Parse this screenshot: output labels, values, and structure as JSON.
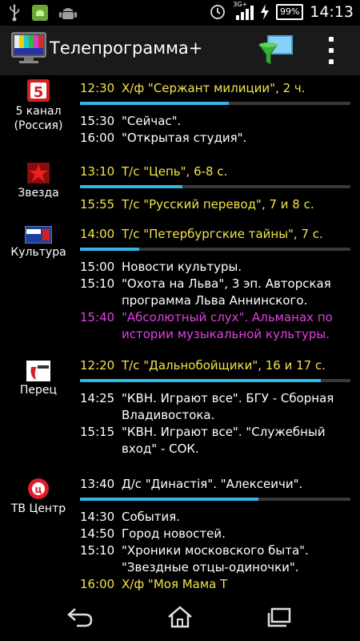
{
  "status_bar": {
    "time": "14:13",
    "battery": "99%",
    "network": "3G+",
    "icons": [
      "usb-icon",
      "android-robot-icon",
      "android-debug-icon",
      "vibrate-icon",
      "signal-icon",
      "charging-icon"
    ]
  },
  "action_bar": {
    "title": "Телепрограмма+",
    "icons": [
      "tv-app-icon",
      "filter-funnel-icon",
      "overflow-menu-icon"
    ]
  },
  "colors": {
    "now_playing": "#f2e34a",
    "highlighted": "#e040e0",
    "progress": "#33b5e5"
  },
  "channels": [
    {
      "name": "5 канал (Россия)",
      "name_line1": "5 канал",
      "name_line2": "(Россия)",
      "progress": 0.55,
      "programs": [
        {
          "time": "12:30",
          "title": "Х/ф \"Сержант милиции\", 2 ч.",
          "style": "now"
        },
        {
          "time": "15:30",
          "title": "\"Сейчас\".",
          "style": "normal"
        },
        {
          "time": "16:00",
          "title": "\"Открытая студия\".",
          "style": "normal"
        }
      ]
    },
    {
      "name": "Звезда",
      "progress": 0.38,
      "programs": [
        {
          "time": "13:10",
          "title": "Т/с \"Цепь\", 6-8 с.",
          "style": "now"
        },
        {
          "time": "15:55",
          "title": "Т/с \"Русский перевод\", 7 и 8 с.",
          "style": "now"
        }
      ]
    },
    {
      "name": "Культура",
      "logo_text": "РОССИЯ К",
      "progress": 0.22,
      "programs": [
        {
          "time": "14:00",
          "title": "Т/с \"Петербургские тайны\", 7 с.",
          "style": "now"
        },
        {
          "time": "15:00",
          "title": "Новости культуры.",
          "style": "normal"
        },
        {
          "time": "15:10",
          "title": "\"Охота на Льва\", 3 эп. Авторская программа Льва Аннинского.",
          "style": "normal"
        },
        {
          "time": "15:40",
          "title": "\"Абсолютный слух\". Альманах по истории музыкальной культуры.",
          "style": "purple"
        }
      ]
    },
    {
      "name": "Перец",
      "logo_text": "перец",
      "progress": 0.89,
      "programs": [
        {
          "time": "12:20",
          "title": "Т/с \"Дальнобойщики\", 16 и 17 с.",
          "style": "now"
        },
        {
          "time": "14:25",
          "title": "\"КВН. Играют все\". БГУ - Сборная Владивостока.",
          "style": "normal"
        },
        {
          "time": "15:15",
          "title": "\"КВН. Играют все\". \"Служебный вход\" - СОК.",
          "style": "normal"
        }
      ]
    },
    {
      "name": "ТВ Центр",
      "progress": 0.66,
      "programs": [
        {
          "time": "13:40",
          "title": "Д/с \"Династiя\". \"Алексеичи\".",
          "style": "normal"
        },
        {
          "time": "14:30",
          "title": "События.",
          "style": "normal"
        },
        {
          "time": "14:50",
          "title": "Город новостей.",
          "style": "normal"
        },
        {
          "time": "15:10",
          "title": "\"Хроники московского быта\". \"Звездные отцы-одиночки\".",
          "style": "normal"
        },
        {
          "time": "16:00",
          "title": "Х/ф \"Моя Мама Т",
          "style": "now"
        }
      ]
    }
  ],
  "nav_bar": {
    "icons": [
      "back-icon",
      "home-icon",
      "recent-apps-icon"
    ]
  }
}
